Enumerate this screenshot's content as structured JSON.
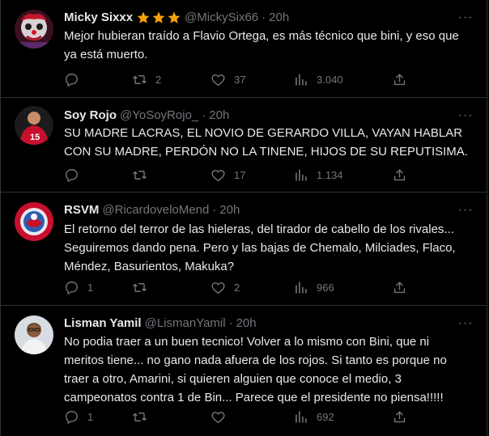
{
  "tweets": [
    {
      "name": "Micky Sixxx",
      "verified_stars": 3,
      "handle": "@MickySix66",
      "time": "20h",
      "text": "Mejor hubieran traído a Flavio Ortega, es más técnico que bini, y eso que\nya está muerto.",
      "replies": "",
      "retweets": "2",
      "likes": "37",
      "views": "3.040"
    },
    {
      "name": "Soy Rojo",
      "handle": "@YoSoyRojo_",
      "time": "20h",
      "text": "SU MADRE LACRAS, EL NOVIO DE GERARDO VILLA, VAYAN HABLAR\nCON SU MADRE, PERDÓN NO LA TINENE, HIJOS DE SU REPUTISIMA.",
      "replies": "",
      "retweets": "",
      "likes": "17",
      "views": "1.134"
    },
    {
      "name": "RSVM",
      "handle": "@RicardoveloMend",
      "time": "20h",
      "text": "El retorno del terror de las hieleras, del tirador de cabello de los rivales...\nSeguiremos dando pena. Pero y las bajas de Chemalo, Milciades, Flaco,\nMéndez, Basurientos, Makuka?",
      "replies": "1",
      "retweets": "",
      "likes": "2",
      "views": "966"
    },
    {
      "name": "Lisman Yamil",
      "handle": "@LismanYamil",
      "time": "20h",
      "text": "No podia traer a un buen tecnico! Volver a lo mismo con Bini, que  ni\nmeritos tiene... no gano nada afuera de los rojos. Si tanto es porque  no\ntraer a otro, Amarini, si quieren alguien que conoce el medio, 3\ncampeonatos contra 1 de Bin... Parece que el presidente no piensa!!!!!",
      "replies": "1",
      "retweets": "",
      "likes": "",
      "views": "692"
    }
  ],
  "separator": "·",
  "more_glyph": "···",
  "colors": {
    "background": "#000000",
    "text": "#e7e9ea",
    "muted": "#71767b",
    "border": "#2f3336",
    "star": "#f4a10a"
  }
}
